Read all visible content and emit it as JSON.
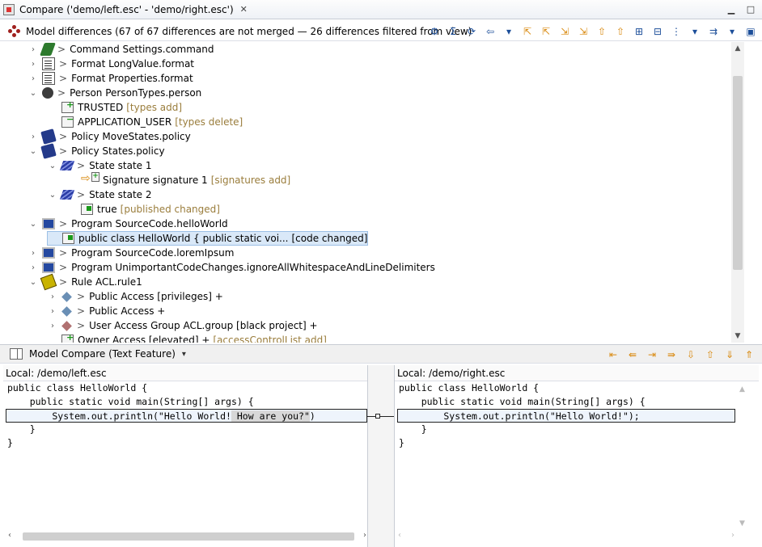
{
  "window": {
    "title": "Compare ('demo/left.esc' - 'demo/right.esc')",
    "close_tab_glyph": "✕",
    "controls": [
      "minimize-icon",
      "maximize-icon",
      "close-icon"
    ]
  },
  "toolbar": {
    "title": "Model differences",
    "summary": "(67 of 67 differences are not merged — 26 differences filtered from view)",
    "icons": [
      {
        "name": "filter-icon",
        "glyph": "⚙"
      },
      {
        "name": "sigma-icon",
        "glyph": "Σ"
      },
      {
        "name": "sync-icon",
        "glyph": "⟳"
      },
      {
        "name": "prev-diff-icon",
        "glyph": "⇦"
      },
      {
        "name": "dropdown-icon",
        "glyph": "▾"
      },
      {
        "name": "copy-left-icon",
        "glyph": "⇱"
      },
      {
        "name": "copy-all-left-icon",
        "glyph": "⇱"
      },
      {
        "name": "copy-right-icon",
        "glyph": "⇲"
      },
      {
        "name": "copy-all-right-icon",
        "glyph": "⇲"
      },
      {
        "name": "next-icon",
        "glyph": "⇧"
      },
      {
        "name": "prev-icon",
        "glyph": "⇧"
      },
      {
        "name": "expand-icon",
        "glyph": "⊞"
      },
      {
        "name": "collapse-icon",
        "glyph": "⊟"
      },
      {
        "name": "group-icon",
        "glyph": "⋮"
      },
      {
        "name": "group-dropdown-icon",
        "glyph": "▾"
      },
      {
        "name": "direction-icon",
        "glyph": "⇉"
      },
      {
        "name": "direction-dropdown-icon",
        "glyph": "▾"
      },
      {
        "name": "save-icon",
        "glyph": "▣"
      }
    ]
  },
  "tree": {
    "gt": ">",
    "rows": [
      {
        "label": "Command Settings.command",
        "kind": "",
        "icon": "cmd"
      },
      {
        "label": "Format LongValue.format",
        "kind": "",
        "icon": "doc"
      },
      {
        "label": "Format Properties.format",
        "kind": "",
        "icon": "doc"
      },
      {
        "label": "Person PersonTypes.person",
        "kind": "",
        "icon": "person"
      },
      {
        "label": "TRUSTED",
        "kind": "[types add]",
        "icon": "add"
      },
      {
        "label": "APPLICATION_USER",
        "kind": "[types delete]",
        "icon": "del"
      },
      {
        "label": "Policy MoveStates.policy",
        "kind": "",
        "icon": "book"
      },
      {
        "label": "Policy States.policy",
        "kind": "",
        "icon": "book"
      },
      {
        "label": "State state 1",
        "kind": "",
        "icon": "state"
      },
      {
        "label": "Signature signature 1",
        "kind": "[signatures add]",
        "icon": "arrowadd"
      },
      {
        "label": "State state 2",
        "kind": "",
        "icon": "state"
      },
      {
        "label": "true",
        "kind": "[published changed]",
        "icon": "chg"
      },
      {
        "label": "Program SourceCode.helloWorld",
        "kind": "",
        "icon": "monitor"
      },
      {
        "label": "public class HelloWorld {      public static voi...",
        "kind": "[code changed]",
        "icon": "chg"
      },
      {
        "label": "Program SourceCode.loremIpsum",
        "kind": "",
        "icon": "monitor"
      },
      {
        "label": "Program UnimportantCodeChanges.ignoreAllWhitespaceAndLineDelimiters",
        "kind": "",
        "icon": "monitor"
      },
      {
        "label": "Rule ACL.rule1",
        "kind": "",
        "icon": "rule"
      },
      {
        "label": "Public Access [privileges] +",
        "kind": "",
        "icon": "diamond"
      },
      {
        "label": "Public Access +",
        "kind": "",
        "icon": "diamond"
      },
      {
        "label": "User Access Group ACL.group [black project] +",
        "kind": "",
        "icon": "diamond red"
      },
      {
        "label": "Owner Access [elevated] +",
        "kind": "[accessControlList add]",
        "icon": "add"
      }
    ]
  },
  "model_compare": {
    "title": "Model Compare (Text Feature)",
    "dropdown_glyph": "▾",
    "icons": [
      {
        "name": "copy-current-left-icon",
        "glyph": "⇤"
      },
      {
        "name": "copy-all-left-icon",
        "glyph": "⇚"
      },
      {
        "name": "copy-current-right-icon",
        "glyph": "⇥"
      },
      {
        "name": "copy-all-right-icon",
        "glyph": "⇛"
      },
      {
        "name": "next-diff-icon",
        "glyph": "⇩"
      },
      {
        "name": "prev-diff-icon",
        "glyph": "⇧"
      },
      {
        "name": "next-change-icon",
        "glyph": "⇓"
      },
      {
        "name": "prev-change-icon",
        "glyph": "⇑"
      }
    ]
  },
  "left_pane": {
    "header": "Local: /demo/left.esc",
    "lines": [
      "public class HelloWorld {",
      "    public static void main(String[] args) {",
      "        System.out.println(\"Hello World!",
      "    }",
      "}"
    ],
    "highlight_insert": " How are you?\"",
    "highlight_tail": ")"
  },
  "right_pane": {
    "header": "Local: /demo/right.esc",
    "lines": [
      "public class HelloWorld {",
      "    public static void main(String[] args) {",
      "        System.out.println(\"Hello World!\");",
      "    }",
      "}"
    ]
  }
}
